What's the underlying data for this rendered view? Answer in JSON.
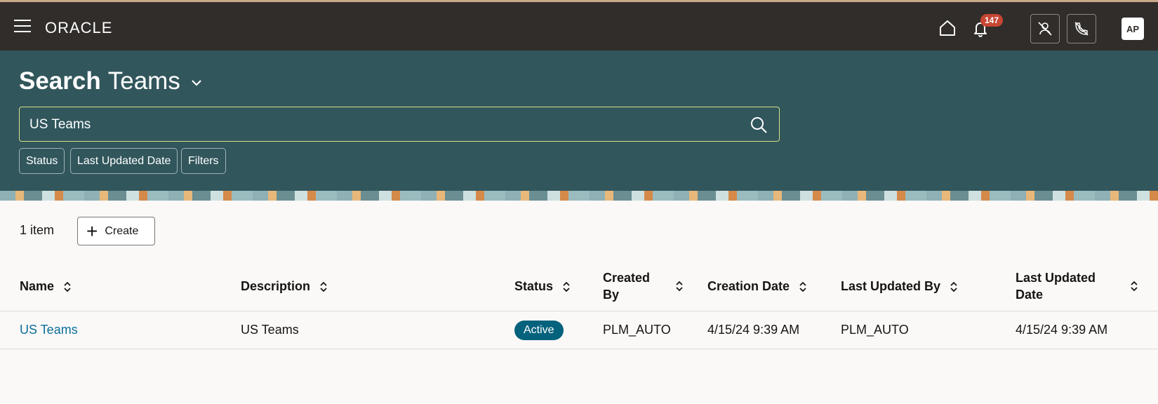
{
  "topbar": {
    "logo": "ORACLE",
    "notification_count": "147",
    "avatar_initials": "AP"
  },
  "header": {
    "title_bold": "Search",
    "title_rest": "Teams",
    "search_value": "US Teams",
    "chips": [
      "Status",
      "Last Updated Date",
      "Filters"
    ]
  },
  "content": {
    "item_count": "1 item",
    "create_label": "Create",
    "columns": [
      "Name",
      "Description",
      "Status",
      "Created By",
      "Creation Date",
      "Last Updated By",
      "Last Updated Date"
    ],
    "rows": [
      {
        "name": "US Teams",
        "description": "US Teams",
        "status": "Active",
        "created_by": "PLM_AUTO",
        "creation_date": "4/15/24 9:39 AM",
        "last_updated_by": "PLM_AUTO",
        "last_updated_date": "4/15/24 9:39 AM"
      }
    ]
  },
  "colors": {
    "topbar": "#312d2a",
    "header": "#31565c",
    "link": "#0a6e99",
    "status_active": "#05627d",
    "badge": "#c74634"
  }
}
